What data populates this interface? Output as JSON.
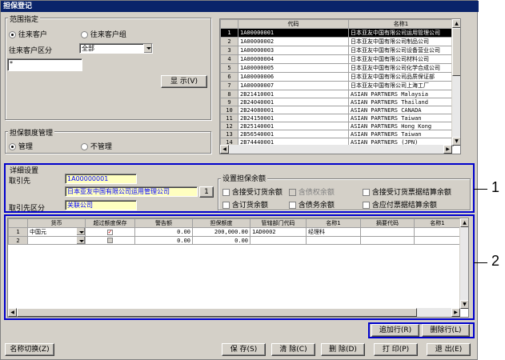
{
  "window": {
    "title": "担保登记"
  },
  "range": {
    "title": "范围指定",
    "radio_customer": "往来客户",
    "radio_customer_group": "往来客户组",
    "class_label": "往来客户区分",
    "class_value": "全部",
    "filter_value": "*",
    "show_button": "显 示(V)"
  },
  "mgmt": {
    "title": "担保额度管理",
    "radio_manage": "管理",
    "radio_nomanage": "不管理"
  },
  "customer_list": {
    "columns": [
      "代码",
      "名称1"
    ],
    "rows": [
      {
        "n": "1",
        "code": "1A00000001",
        "name": "日本亚友中国有限公司运用管理公司"
      },
      {
        "n": "2",
        "code": "1A00000002",
        "name": "日本亚友中国有限公司制品公司"
      },
      {
        "n": "3",
        "code": "1A00000003",
        "name": "日本亚友中国有限公司设备营业公司"
      },
      {
        "n": "4",
        "code": "1A00000004",
        "name": "日本亚友中国有限公司材料公司"
      },
      {
        "n": "5",
        "code": "1A00000005",
        "name": "日本亚友中国有限公司化学合成公司"
      },
      {
        "n": "6",
        "code": "1A00000006",
        "name": "日本亚友中国有限公司品质保证部"
      },
      {
        "n": "7",
        "code": "1A00000007",
        "name": "日本亚友中国有限公司上海工厂"
      },
      {
        "n": "8",
        "code": "2B21410001",
        "name": "ASIAN PARTNERS Malaysia"
      },
      {
        "n": "9",
        "code": "2B24040001",
        "name": "ASIAN PARTNERS Thailand"
      },
      {
        "n": "10",
        "code": "2B24080001",
        "name": "ASIAN PARTNERS CANADA"
      },
      {
        "n": "11",
        "code": "2B24150001",
        "name": "ASIAN PARTNERS Taiwan"
      },
      {
        "n": "12",
        "code": "2B25140001",
        "name": "ASIAN PARTNERS Hong Kong"
      },
      {
        "n": "13",
        "code": "2B56540001",
        "name": "ASIAN PARTNERS Taiwan"
      },
      {
        "n": "14",
        "code": "2B74440001",
        "name": "ASIAN PARTNERS (JPN)"
      }
    ]
  },
  "detail": {
    "title": "详细设置",
    "partner_label": "取引先",
    "partner_code": "1A00000001",
    "partner_name": "日本亚友中国有限公司运用管理公司",
    "partner_btn": "1",
    "partner_class_label": "取引先区分",
    "partner_class_value": "关联公司",
    "balance_title": "设置担保余额",
    "checks": [
      {
        "label": "含接受订货余额",
        "disabled": false
      },
      {
        "label": "含债权余额",
        "disabled": true
      },
      {
        "label": "含接受订货票据结算余额",
        "disabled": false
      },
      {
        "label": "含订货余额",
        "disabled": false
      },
      {
        "label": "含债务余额",
        "disabled": false
      },
      {
        "label": "含应付票据结算余额",
        "disabled": false
      }
    ]
  },
  "guarantee_grid": {
    "columns": [
      "货币",
      "超过额度保存",
      "警告额",
      "担保额度",
      "管辖部门代码",
      "名称1",
      "摘要代码",
      "名称1"
    ],
    "rows": [
      {
        "n": "1",
        "currency": "中国元",
        "warn": "0.00",
        "limit": "200,000.00",
        "dept": "1AD0002",
        "name": "经理科"
      },
      {
        "n": "2",
        "currency": "",
        "warn": "0.00",
        "limit": "0.00",
        "dept": "",
        "name": ""
      }
    ]
  },
  "grid_buttons": {
    "add_row": "追加行(R)",
    "delete_row": "删除行(L)"
  },
  "footer": {
    "name_switch": "名称切换(Z)",
    "save": "保 存(S)",
    "clear": "清 除(C)",
    "delete": "删 除(D)",
    "print": "打 印(P)",
    "exit": "退 出(E)"
  },
  "callouts": {
    "one": "1",
    "two": "2"
  },
  "colors": {
    "title_bar": "#0a246a",
    "highlight_border": "#0000cc",
    "yellow_field": "#ffffc0"
  }
}
